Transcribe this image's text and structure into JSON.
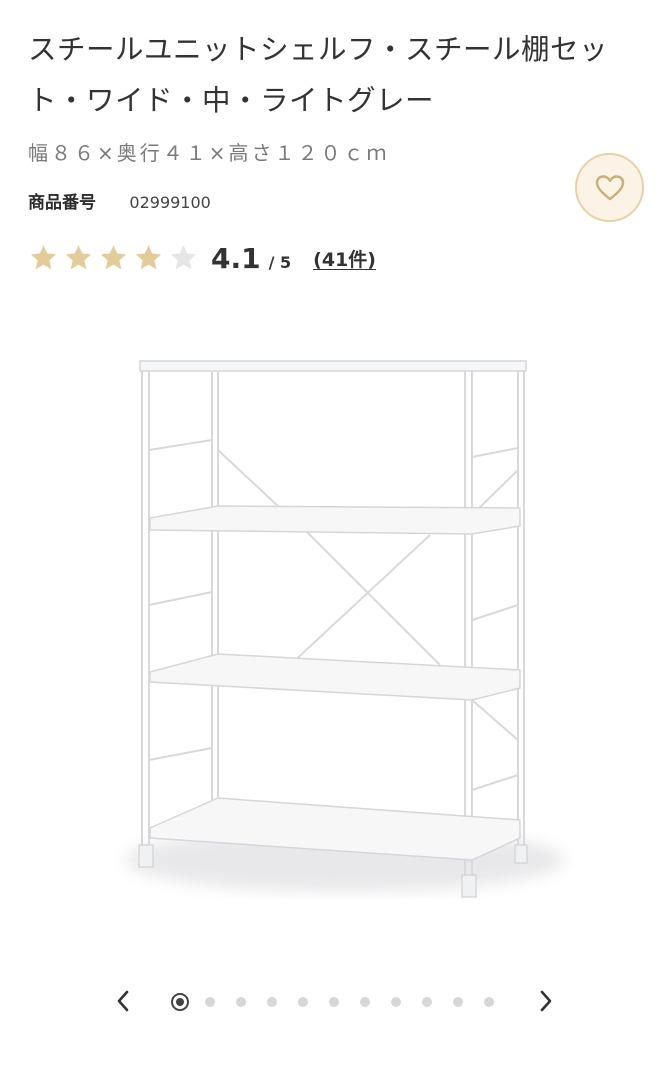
{
  "product": {
    "title": "スチールユニットシェルフ・スチール棚セット・ワイド・中・ライトグレー",
    "spec": "幅８６×奥行４１×高さ１２０ｃｍ",
    "product_no_label": "商品番号",
    "product_no": "02999100"
  },
  "rating": {
    "value": 4.1,
    "score": "4.1",
    "out_of": "/ 5",
    "count": "(41件)",
    "filled_stars": 4,
    "total_stars": 5,
    "star_color": "#e4cc98",
    "empty_star_color": "#e6e6e6"
  },
  "favorite": {
    "icon": "heart-icon",
    "bg_color": "#faf3e6",
    "border_color": "#e7d2a6"
  },
  "carousel": {
    "image": "steel-unit-shelf-product-photo",
    "current_index": 1,
    "total": 11,
    "prev_icon": "chevron-left-icon",
    "next_icon": "chevron-right-icon"
  }
}
